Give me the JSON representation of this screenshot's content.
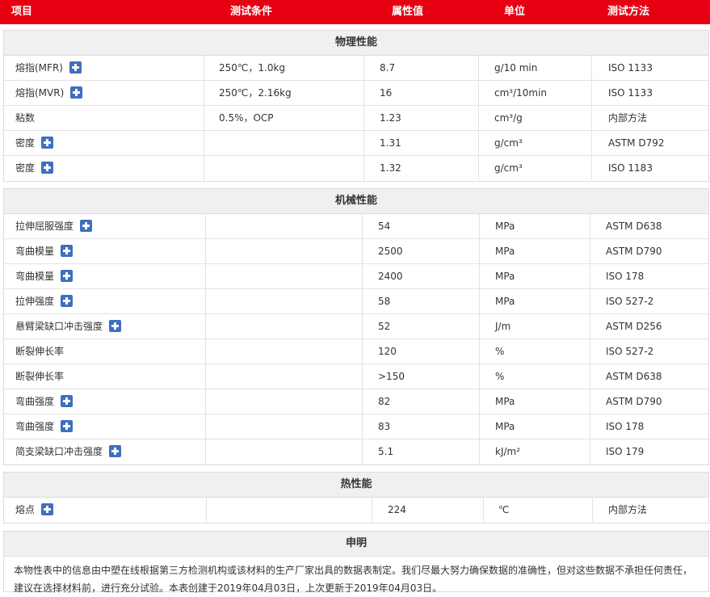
{
  "header": {
    "col_item": "项目",
    "col_condition": "测试条件",
    "col_value": "属性值",
    "col_unit": "单位",
    "col_method": "测试方法"
  },
  "sections": {
    "physical": {
      "title": "物理性能",
      "rows": [
        {
          "name": "熔指(MFR)",
          "has_plus": true,
          "condition": "250℃，1.0kg",
          "value": "8.7",
          "unit": "g/10 min",
          "method": "ISO 1133"
        },
        {
          "name": "熔指(MVR)",
          "has_plus": true,
          "condition": "250℃，2.16kg",
          "value": "16",
          "unit": "cm³/10min",
          "method": "ISO 1133"
        },
        {
          "name": "粘数",
          "has_plus": false,
          "condition": "0.5%，OCP",
          "value": "1.23",
          "unit": "cm³/g",
          "method": "内部方法"
        },
        {
          "name": "密度",
          "has_plus": true,
          "condition": "",
          "value": "1.31",
          "unit": "g/cm³",
          "method": "ASTM D792"
        },
        {
          "name": "密度",
          "has_plus": true,
          "condition": "",
          "value": "1.32",
          "unit": "g/cm³",
          "method": "ISO 1183"
        }
      ]
    },
    "mechanical": {
      "title": "机械性能",
      "rows": [
        {
          "name": "拉伸屈服强度",
          "has_plus": true,
          "condition": "",
          "value": "54",
          "unit": "MPa",
          "method": "ASTM D638"
        },
        {
          "name": "弯曲模量",
          "has_plus": true,
          "condition": "",
          "value": "2500",
          "unit": "MPa",
          "method": "ASTM D790"
        },
        {
          "name": "弯曲模量",
          "has_plus": true,
          "condition": "",
          "value": "2400",
          "unit": "MPa",
          "method": "ISO 178"
        },
        {
          "name": "拉伸强度",
          "has_plus": true,
          "condition": "",
          "value": "58",
          "unit": "MPa",
          "method": "ISO 527-2"
        },
        {
          "name": "悬臂梁缺口冲击强度",
          "has_plus": true,
          "condition": "",
          "value": "52",
          "unit": "J/m",
          "method": "ASTM D256"
        },
        {
          "name": "断裂伸长率",
          "has_plus": false,
          "condition": "",
          "value": "120",
          "unit": "%",
          "method": "ISO 527-2"
        },
        {
          "name": "断裂伸长率",
          "has_plus": false,
          "condition": "",
          "value": ">150",
          "unit": "%",
          "method": "ASTM D638"
        },
        {
          "name": "弯曲强度",
          "has_plus": true,
          "condition": "",
          "value": "82",
          "unit": "MPa",
          "method": "ASTM D790"
        },
        {
          "name": "弯曲强度",
          "has_plus": true,
          "condition": "",
          "value": "83",
          "unit": "MPa",
          "method": "ISO 178"
        },
        {
          "name": "简支梁缺口冲击强度",
          "has_plus": true,
          "condition": "",
          "value": "5.1",
          "unit": "kJ/m²",
          "method": "ISO 179"
        }
      ]
    },
    "thermal": {
      "title": "热性能",
      "rows": [
        {
          "name": "熔点",
          "has_plus": true,
          "condition": "",
          "value": "224",
          "unit": "℃",
          "method": "内部方法"
        }
      ]
    }
  },
  "statement": {
    "title": "申明",
    "text": "本物性表中的信息由中塑在线根据第三方检测机构或该材料的生产厂家出具的数据表制定。我们尽最大努力确保数据的准确性，但对这些数据不承担任何责任，建议在选择材料前，进行充分试验。本表创建于2019年04月03日，上次更新于2019年04月03日。"
  },
  "colors": {
    "header_bg": "#e60012",
    "section_title_bg": "#f0f0f0",
    "plus_icon": "#3f6fbf"
  }
}
